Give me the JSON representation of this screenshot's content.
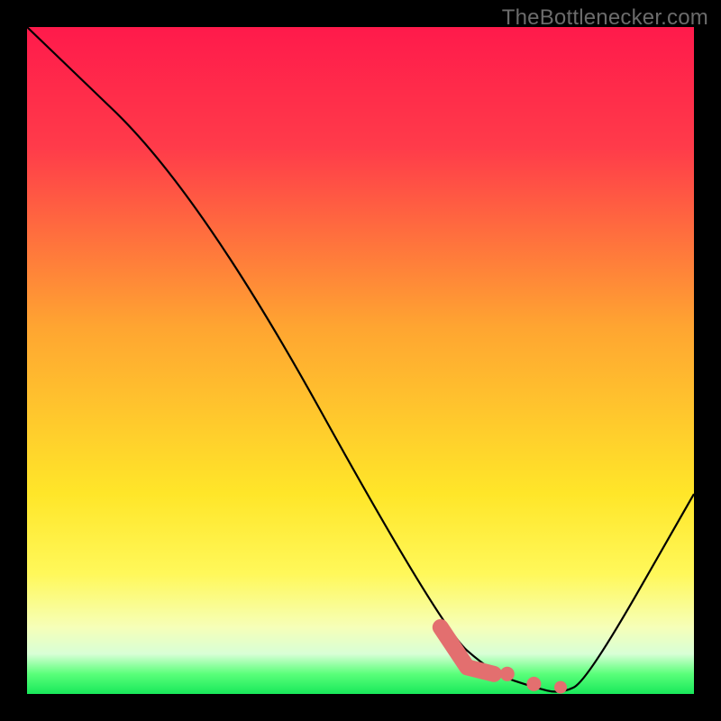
{
  "watermark": "TheBottlenecker.com",
  "chart_data": {
    "type": "line",
    "title": "",
    "xlabel": "",
    "ylabel": "",
    "xlim": [
      0,
      100
    ],
    "ylim": [
      0,
      100
    ],
    "gradient_stops": [
      {
        "offset": 0,
        "color": "#ff1a4b"
      },
      {
        "offset": 18,
        "color": "#ff3b4a"
      },
      {
        "offset": 45,
        "color": "#ffa531"
      },
      {
        "offset": 70,
        "color": "#ffe629"
      },
      {
        "offset": 82,
        "color": "#fff85a"
      },
      {
        "offset": 90,
        "color": "#f6ffb8"
      },
      {
        "offset": 94,
        "color": "#d8ffd6"
      },
      {
        "offset": 97,
        "color": "#5aff7a"
      },
      {
        "offset": 100,
        "color": "#18e85a"
      }
    ],
    "series": [
      {
        "name": "bottleneck-curve",
        "color": "#000000",
        "x": [
          0,
          26,
          62,
          70,
          76,
          80,
          84,
          100
        ],
        "y": [
          100,
          75,
          10,
          3,
          1,
          0,
          2,
          30
        ]
      }
    ],
    "highlight": {
      "name": "optimal-segment",
      "color": "#e36f6f",
      "style": "thick-dotted",
      "x": [
        62,
        66,
        70,
        72,
        76,
        80
      ],
      "y": [
        10,
        4,
        3,
        3,
        1.5,
        1
      ]
    }
  }
}
